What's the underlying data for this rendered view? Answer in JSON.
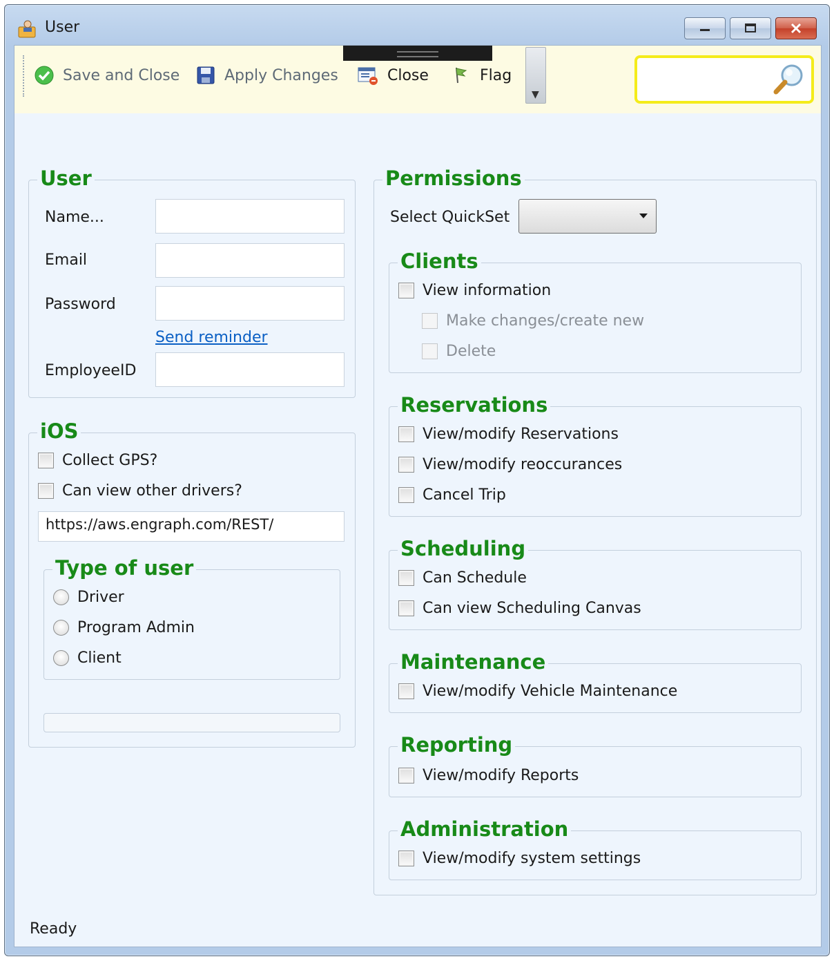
{
  "window": {
    "title": "User"
  },
  "toolbar": {
    "save_close": "Save and Close",
    "apply_changes": "Apply Changes",
    "close": "Close",
    "flag": "Flag",
    "search_value": ""
  },
  "user": {
    "legend": "User",
    "name_label": "Name...",
    "email_label": "Email",
    "password_label": "Password",
    "send_reminder": "Send reminder",
    "employee_label": "EmployeeID",
    "name_value": "",
    "email_value": "",
    "password_value": "",
    "employee_value": ""
  },
  "ios": {
    "legend": "iOS",
    "collect_gps": "Collect GPS?",
    "view_drivers": "Can view other drivers?",
    "url": "https://aws.engraph.com/REST/",
    "type_legend": "Type of user",
    "types": [
      "Driver",
      "Program Admin",
      "Client"
    ]
  },
  "permissions": {
    "legend": "Permissions",
    "quickset_label": "Select QuickSet",
    "quickset_value": "",
    "clients": {
      "legend": "Clients",
      "items": [
        "View information",
        "Make changes/create new",
        "Delete"
      ]
    },
    "reservations": {
      "legend": "Reservations",
      "items": [
        "View/modify Reservations",
        "View/modify reoccurances",
        "Cancel Trip"
      ]
    },
    "scheduling": {
      "legend": "Scheduling",
      "items": [
        "Can Schedule",
        "Can view Scheduling Canvas"
      ]
    },
    "maintenance": {
      "legend": "Maintenance",
      "items": [
        "View/modify Vehicle Maintenance"
      ]
    },
    "reporting": {
      "legend": "Reporting",
      "items": [
        "View/modify Reports"
      ]
    },
    "administration": {
      "legend": "Administration",
      "items": [
        "View/modify system settings"
      ]
    }
  },
  "status": {
    "text": "Ready"
  },
  "colors": {
    "legend_green": "#188a18",
    "toolbar_bg": "#fdfbe3",
    "search_border": "#f4ec1a",
    "link_blue": "#0a5fc4"
  }
}
